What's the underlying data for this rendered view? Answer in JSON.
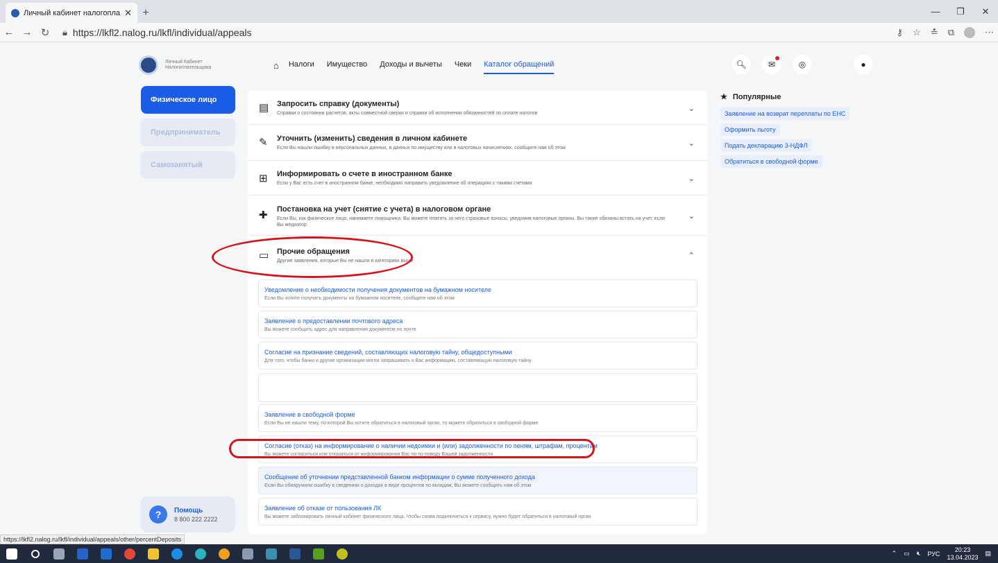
{
  "browser": {
    "tab_title": "Личный кабинет налогоплател",
    "url": "https://lkfl2.nalog.ru/lkfl/individual/appeals",
    "status_url": "https://lkfl2.nalog.ru/lkfl/individual/appeals/other/percentDeposits"
  },
  "header": {
    "logo_text": "Личный Кабинет Налогоплательщика",
    "nav": [
      "Налоги",
      "Имущество",
      "Доходы и вычеты",
      "Чеки",
      "Каталог обращений"
    ]
  },
  "sidebar": {
    "items": [
      "Физическое лицо",
      "Предприниматель",
      "Самозанятый"
    ]
  },
  "help": {
    "title": "Помощь",
    "phone": "8 800 222 2222"
  },
  "categories": [
    {
      "title": "Запросить справку (документы)",
      "desc": "Справки о состоянии расчетов, акты совместной сверки и справки об исполнении обязанностей по оплате налогов",
      "icon": "document-icon"
    },
    {
      "title": "Уточнить (изменить) сведения в личном кабинете",
      "desc": "Если Вы нашли ошибку в персональных данных, в данных по имуществу или в налоговых начислениях, сообщите нам об этом",
      "icon": "edit-icon"
    },
    {
      "title": "Информировать о счете в иностранном банке",
      "desc": "Если у Вас есть счет в иностранном банке, необходимо направить уведомление об операциях с такими счетами",
      "icon": "bank-icon"
    },
    {
      "title": "Постановка на учет (снятие с учета) в налоговом органе",
      "desc": "Если Вы, как физическое лицо, нанимаете помощника, Вы можете платить за него страховые взносы, уведомив налоговые органы. Вы также обязаны встать на учет, если Вы медиатор",
      "icon": "register-icon"
    },
    {
      "title": "Прочие обращения",
      "desc": "Другие заявления, которые Вы не нашли в категориях выше",
      "icon": "folder-icon"
    }
  ],
  "subitems": [
    {
      "title": "Уведомление о необходимости получения документов на бумажном носителе",
      "desc": "Если Вы хотите получать документы на бумажном носителе, сообщите нам об этом"
    },
    {
      "title": "Заявление о предоставлении почтового адреса",
      "desc": "Вы можете сообщить адрес для направления документов по почте"
    },
    {
      "title": "Согласие на признание сведений, составляющих налоговую тайну, общедоступными",
      "desc": "Для того, чтобы банки и другие организации могли запрашивать о Вас информацию, составляющую налоговую тайну"
    },
    {
      "title": "",
      "desc": ""
    },
    {
      "title": "Заявление в свободной форме",
      "desc": "Если Вы не нашли тему, по которой Вы хотите обратиться в налоговый орган, то можете обратиться в свободной форме"
    },
    {
      "title": "Согласие (отказ) на информирование о наличии недоимки и (или) задолженности по пеням, штрафам, процентам",
      "desc": "Вы можете согласиться или отказаться от информирования Вас по по поводу Вашей задолженности"
    },
    {
      "title": "Сообщение об уточнении представленной банком информации о сумме полученного дохода",
      "desc": "Если Вы обнаружили ошибку в сведениях о доходах в виде процентов по вкладам, Вы можете сообщить нам об этом"
    },
    {
      "title": "Заявление об отказе от пользования ЛК",
      "desc": "Вы можете заблокировать личный кабинет физического лица. Чтобы снова подключиться к сервису, нужно будет обратиться в налоговый орган"
    }
  ],
  "popular": {
    "title": "Популярные",
    "items": [
      "Заявление на возврат переплаты по ЕНС",
      "Оформить льготу",
      "Подать декларацию 3-НДФЛ",
      "Обратиться в свободной форме"
    ]
  },
  "taskbar": {
    "lang": "РУС",
    "time": "20:23",
    "date": "13.04.2023"
  }
}
